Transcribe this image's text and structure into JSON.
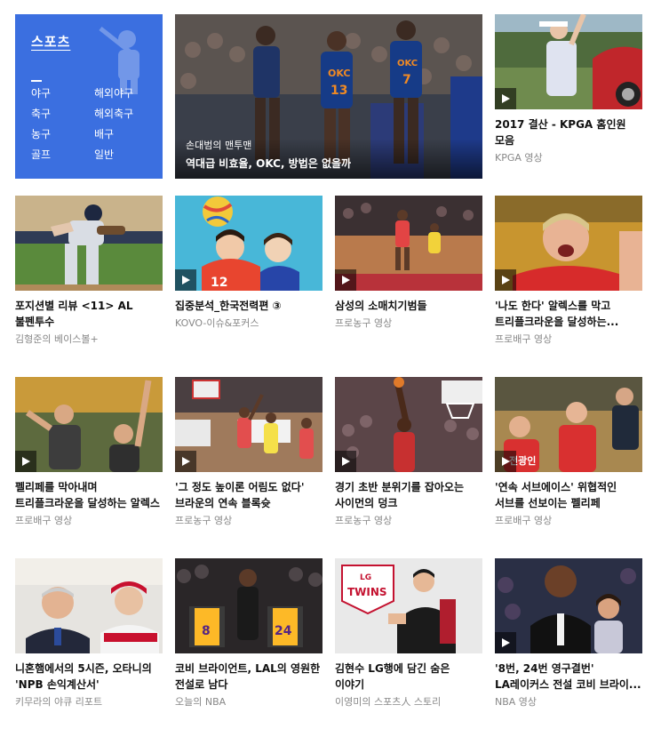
{
  "sports_menu": {
    "title": "스포츠",
    "links": [
      "야구",
      "해외야구",
      "축구",
      "해외축구",
      "농구",
      "배구",
      "골프",
      "일반"
    ]
  },
  "featured": {
    "caption_top": "손대범의 맨투맨",
    "caption_main": "역대급 비효율, OKC, 방법은 없을까"
  },
  "cards": [
    {
      "title": "2017 결산 - KPGA 홈인원 모음",
      "source": "KPGA 영상"
    },
    {
      "title": "포지션별 리뷰 <11> AL 불펜투수",
      "source": "김형준의 베이스볼+"
    },
    {
      "title": "집중분석_한국전력편 ③",
      "source": "KOVO-이슈&포커스"
    },
    {
      "title": "삼성의 소매치기범들",
      "source": "프로농구 영상"
    },
    {
      "title": "'나도 한다' 알렉스를 막고 트리플크라운을 달성하는...",
      "source": "프로배구 영상"
    },
    {
      "title": "펠리페를 막아내며 트리플크라운을 달성하는 알렉스",
      "source": "프로배구 영상"
    },
    {
      "title": "'그 정도 높이론 어림도 없다' 브라운의 연속 블록슛",
      "source": "프로농구 영상"
    },
    {
      "title": "경기 초반 분위기를 잡아오는 사이먼의 덩크",
      "source": "프로농구 영상"
    },
    {
      "title": "'연속 서브에이스' 위협적인 서브를 선보이는 펠리페",
      "source": "프로배구 영상"
    },
    {
      "title": "니혼햄에서의 5시즌, 오타니의 'NPB 손익계산서'",
      "source": "키무라의 야큐 리포트"
    },
    {
      "title": "코비 브라이언트, LAL의 영원한 전설로 남다",
      "source": "오늘의 NBA"
    },
    {
      "title": "김현수 LG행에 담긴 숨은 이야기",
      "source": "이영미의 스포츠人 스토리"
    },
    {
      "title": "'8번, 24번 영구결번' LA레이커스 전설 코비 브라이...",
      "source": "NBA 영상"
    }
  ],
  "thumb_text": {
    "okc": "OKC",
    "num13": "13",
    "num7": "7",
    "num12": "12",
    "twins": "TWINS",
    "lg": "LG",
    "j8": "8",
    "j24": "24",
    "jeonkwang": "전광인"
  },
  "colors": {
    "menu_bg": "#3b6fe0",
    "source_gray": "#888888"
  }
}
